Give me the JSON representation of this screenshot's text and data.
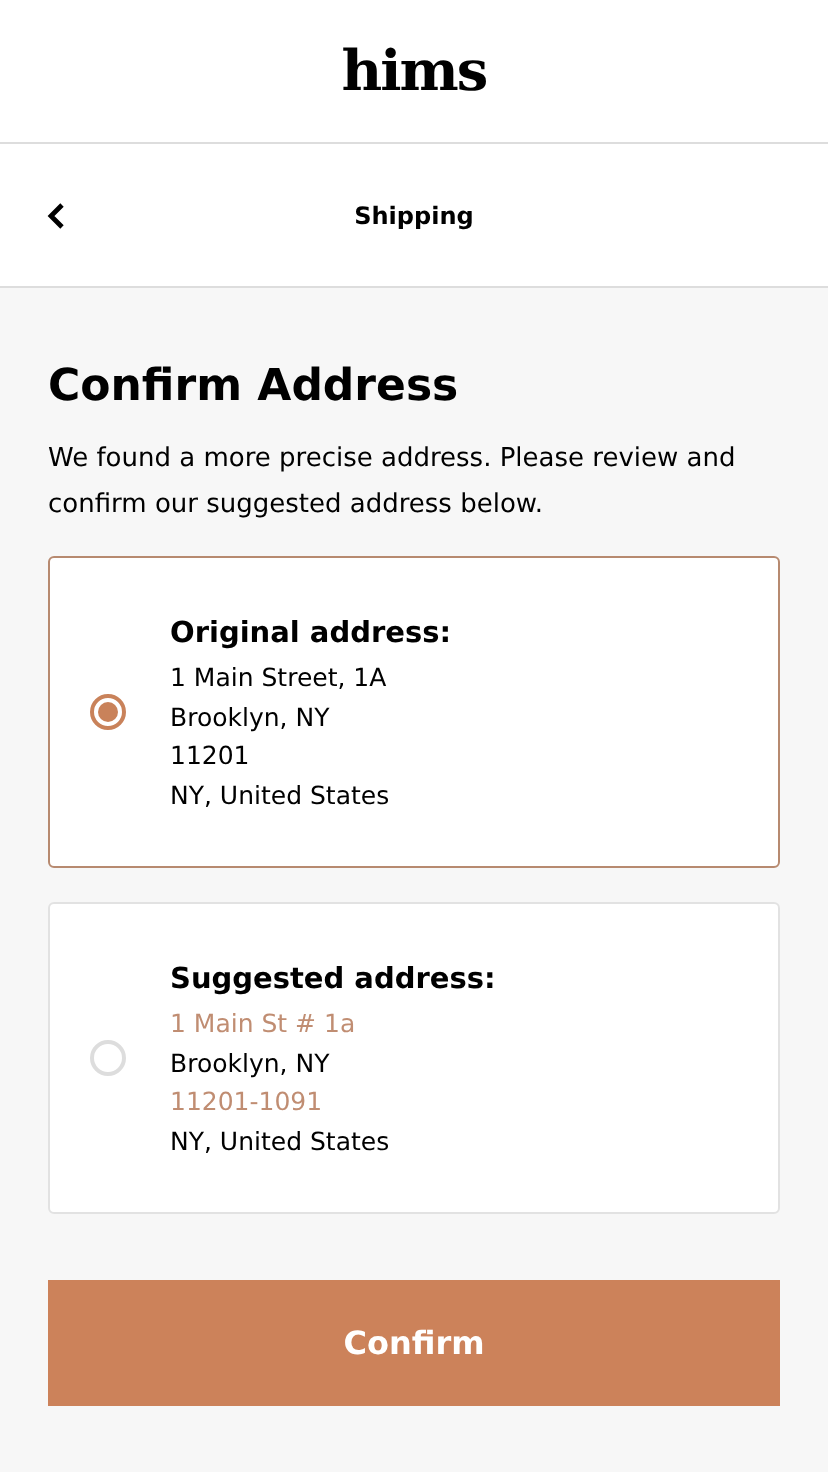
{
  "header": {
    "logo": "hims"
  },
  "nav": {
    "title": "Shipping"
  },
  "heading": "Confirm Address",
  "intro": "We found a more precise address. Please review and confirm our suggested address below.",
  "addresses": [
    {
      "title": "Original address:",
      "selected": true,
      "lines": [
        {
          "text": "1 Main Street, 1A",
          "changed": false
        },
        {
          "text": "Brooklyn, NY",
          "changed": false
        },
        {
          "text": "11201",
          "changed": false
        },
        {
          "text": "NY, United States",
          "changed": false
        }
      ]
    },
    {
      "title": "Suggested address:",
      "selected": false,
      "lines": [
        {
          "text": "1 Main St # 1a",
          "changed": true
        },
        {
          "text": "Brooklyn, NY",
          "changed": false
        },
        {
          "text": "11201-1091",
          "changed": true
        },
        {
          "text": "NY, United States",
          "changed": false
        }
      ]
    }
  ],
  "confirm_button": "Confirm"
}
